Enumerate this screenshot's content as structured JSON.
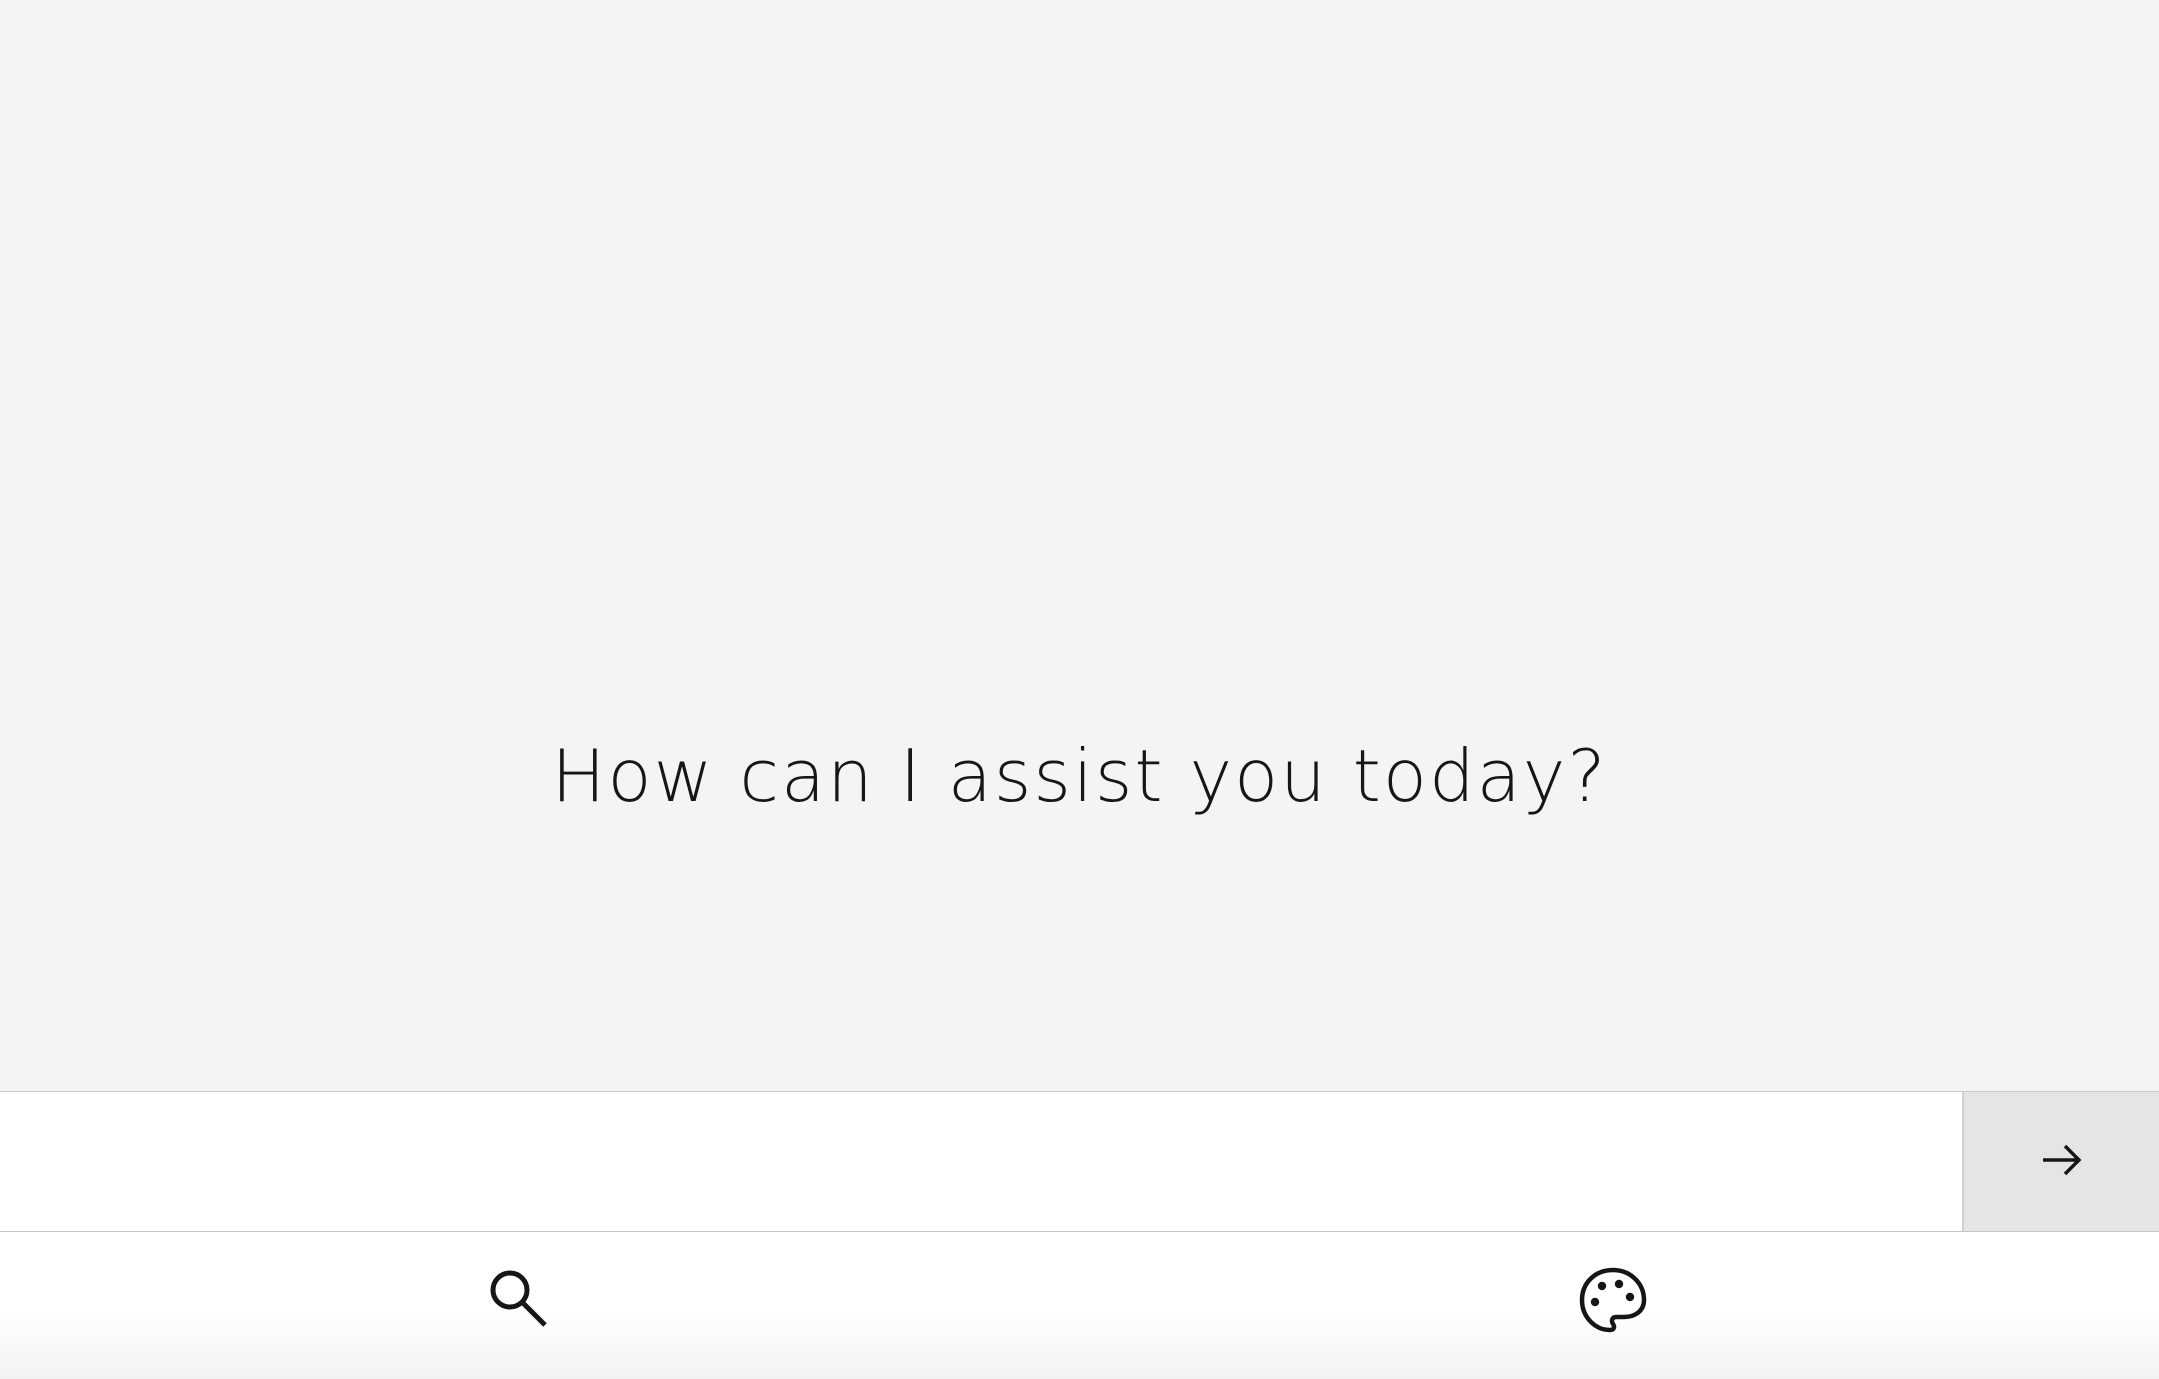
{
  "chat": {
    "greeting": "How can I assist you today?"
  },
  "composer": {
    "value": "",
    "placeholder": "",
    "send_icon": "arrow-right-icon"
  },
  "toolbar": {
    "items": [
      {
        "icon": "search-icon"
      },
      {
        "icon": "palette-icon"
      }
    ]
  },
  "colors": {
    "background": "#f4f4f4",
    "text": "#161616",
    "send_button_bg": "#e5e5e5",
    "input_bg": "#ffffff"
  }
}
